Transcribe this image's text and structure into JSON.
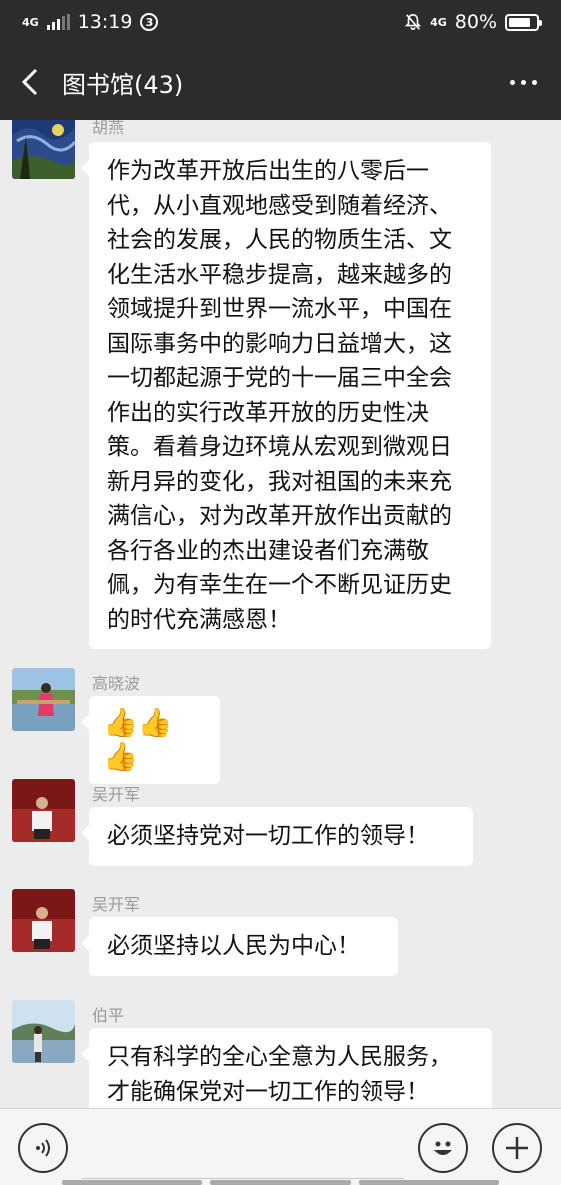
{
  "status_bar": {
    "network_left": "4G",
    "time": "13:19",
    "notification_count": "3",
    "network_right": "4G",
    "battery": "80%",
    "battery_level": 0.8
  },
  "header": {
    "title": "图书馆(43)"
  },
  "messages": [
    {
      "sender": "胡燕",
      "lines": [
        "作为改革开放后出生的八零后一",
        "代，从小直观地感受到随着经济、",
        "社会的发展，人民的物质生活、文",
        "化生活水平稳步提高，越来越多的",
        "领域提升到世界一流水平，中国在",
        "国际事务中的影响力日益增大，这",
        "一切都起源于党的十一届三中全会",
        "作出的实行改革开放的历史性决",
        "策。看着身边环境从宏观到微观日",
        "新月异的变化，我对祖国的未来充",
        "满信心，对为改革开放作出贡献的",
        "各行各业的杰出建设者们充满敬",
        "佩，为有幸生在一个不断见证历史",
        "的时代充满感恩！"
      ]
    },
    {
      "sender": "高晓波",
      "content": "👍👍👍"
    },
    {
      "sender": "吴开军",
      "content": "必须坚持党对一切工作的领导！"
    },
    {
      "sender": "吴开军",
      "content": "必须坚持以人民为中心！"
    },
    {
      "sender": "伯平",
      "lines": [
        "只有科学的全心全意为人民服务，",
        "才能确保党对一切工作的领导！"
      ]
    }
  ],
  "colors": {
    "header_bg": "#2c2c2c",
    "chat_bg": "#ececec",
    "bubble_bg": "#ffffff"
  }
}
